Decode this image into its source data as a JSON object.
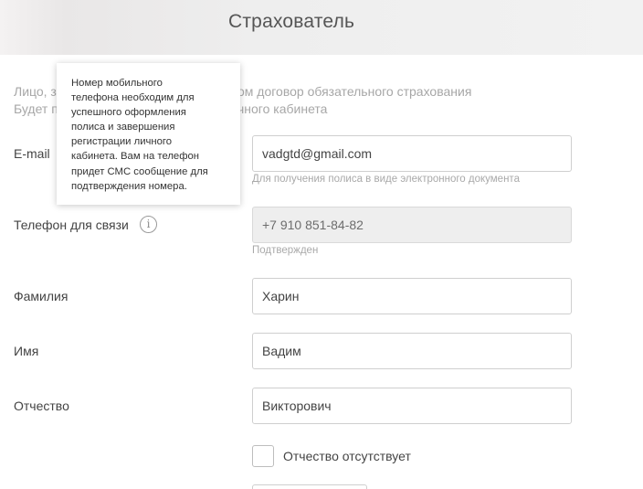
{
  "header": {
    "title": "Страхователь"
  },
  "intro": {
    "line1_left": "Лицо, з",
    "line1_right": "ом договор обязательного страхования",
    "line2_left": "Будет п",
    "line2_right": "чного кабинета"
  },
  "tooltip": {
    "lines": [
      "Номер мобильного",
      "телефона необходим для",
      "успешного оформления",
      "полиса и завершения",
      "регистрации личного",
      "кабинета. Вам на телефон",
      "придет СМС сообщение для",
      "подтверждения номера."
    ]
  },
  "info_icon": {
    "glyph": "i",
    "icon": "info-icon"
  },
  "fields": {
    "email": {
      "label": "E-mail",
      "value": "vadgtd@gmail.com",
      "hint": "Для получения полиса в виде электронного документа"
    },
    "phone": {
      "label": "Телефон для связи",
      "value": "+7 910 851-84-82",
      "hint": "Подтвержден"
    },
    "last_name": {
      "label": "Фамилия",
      "value": "Харин"
    },
    "first_name": {
      "label": "Имя",
      "value": "Вадим"
    },
    "middle_name": {
      "label": "Отчество",
      "value": "Викторович"
    }
  },
  "no_middle_name": {
    "label": "Отчество отсутствует",
    "checked": false
  }
}
